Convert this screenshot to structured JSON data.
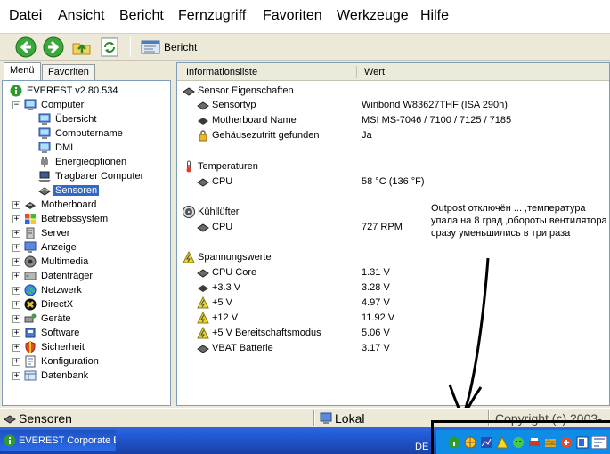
{
  "menu": [
    "Datei",
    "Ansicht",
    "Bericht",
    "Fernzugriff",
    "Favoriten",
    "Werkzeuge",
    "Hilfe"
  ],
  "toolbar": {
    "back_icon": "back-arrow-icon",
    "forward_icon": "forward-arrow-icon",
    "up_icon": "folder-up-icon",
    "refresh_icon": "refresh-icon",
    "report_label": "Bericht"
  },
  "left_tabs": [
    "Menü",
    "Favoriten"
  ],
  "tree": {
    "root": "EVEREST v2.80.534",
    "computer": "Computer",
    "computer_children": [
      "Übersicht",
      "Computername",
      "DMI",
      "Energieoptionen",
      "Tragbarer Computer",
      "Sensoren"
    ],
    "selected": "Sensoren",
    "categories": [
      "Motherboard",
      "Betriebssystem",
      "Server",
      "Anzeige",
      "Multimedia",
      "Datenträger",
      "Netzwerk",
      "DirectX",
      "Geräte",
      "Software",
      "Sicherheit",
      "Konfiguration",
      "Datenbank"
    ]
  },
  "list": {
    "columns": [
      "Informationsliste",
      "Wert"
    ],
    "sections": [
      {
        "title": "Sensor Eigenschaften",
        "items": [
          {
            "name": "Sensortyp",
            "value": "Winbond W83627THF  (ISA 290h)"
          },
          {
            "name": "Motherboard Name",
            "value": "MSI MS-7046 / 7100 / 7125 / 7185"
          },
          {
            "name": "Gehäusezutritt gefunden",
            "value": "Ja"
          }
        ]
      },
      {
        "title": "Temperaturen",
        "items": [
          {
            "name": "CPU",
            "value": "58 °C  (136 °F)"
          }
        ]
      },
      {
        "title": "Kühllüfter",
        "items": [
          {
            "name": "CPU",
            "value": "727 RPM"
          }
        ]
      },
      {
        "title": "Spannungswerte",
        "items": [
          {
            "name": "CPU Core",
            "value": "1.31 V"
          },
          {
            "name": "+3.3 V",
            "value": "3.28 V"
          },
          {
            "name": "+5 V",
            "value": "4.97 V"
          },
          {
            "name": "+12 V",
            "value": "11.92 V"
          },
          {
            "name": "+5 V Bereitschaftsmodus",
            "value": "5.06 V"
          },
          {
            "name": "VBAT Batterie",
            "value": "3.17 V"
          }
        ]
      }
    ]
  },
  "annotation": "Outpost отключён ... ,температура упала на 8 град ,обороты вентилятора сразу уменьшились в три раза",
  "status": {
    "left": "Sensoren",
    "middle": "Lokal",
    "right": "Copyright (c) 2003-"
  },
  "taskbar": {
    "button": "EVEREST Corporate E...",
    "language": "DE"
  },
  "colors": {
    "selection": "#316ac5",
    "taskbar": "#245edb",
    "tray": "#0f8de6"
  }
}
